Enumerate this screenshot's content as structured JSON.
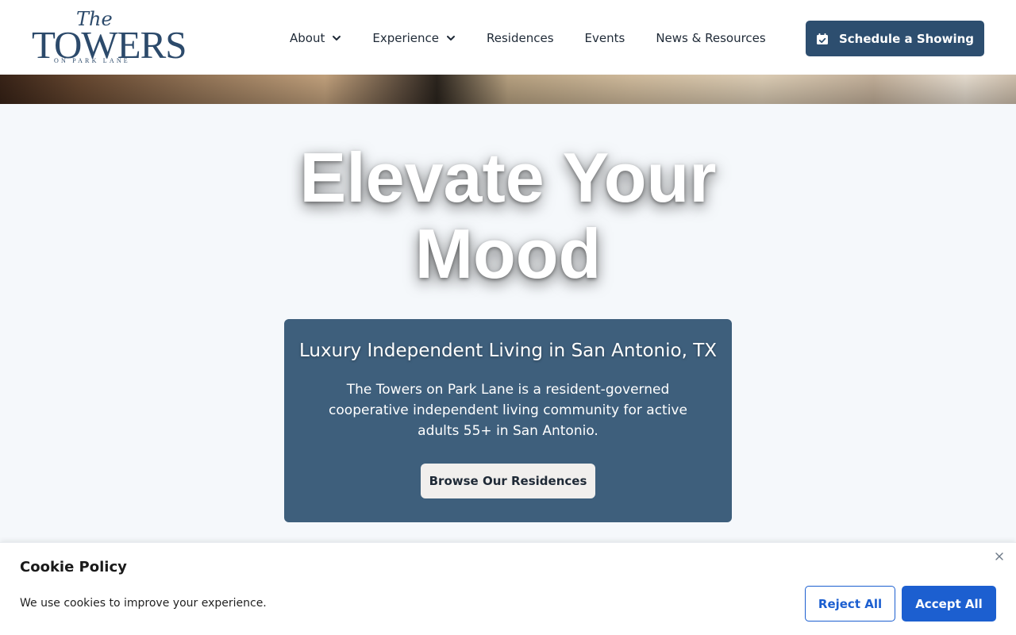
{
  "brand": {
    "logo_the": "The",
    "logo_towers": "TOWERS",
    "logo_sub": "ON PARK LANE"
  },
  "nav": {
    "items": [
      {
        "label": "About",
        "has_dropdown": true
      },
      {
        "label": "Experience",
        "has_dropdown": true
      },
      {
        "label": "Residences",
        "has_dropdown": false
      },
      {
        "label": "Events",
        "has_dropdown": false
      },
      {
        "label": "News & Resources",
        "has_dropdown": false
      }
    ],
    "cta_label": "Schedule a Showing",
    "cta_icon": "calendar-check-icon"
  },
  "hero": {
    "headline_line1": "Elevate Your",
    "headline_line2": "Mood",
    "card_title": "Luxury Independent Living in San Antonio, TX",
    "card_body": "The Towers on Park Lane is a resident-governed cooperative independent living community for active adults 55+ in San Antonio.",
    "card_button": "Browse Our Residences"
  },
  "cookie": {
    "title": "Cookie Policy",
    "text": "We use cookies to improve your experience.",
    "reject_label": "Reject All",
    "accept_label": "Accept All",
    "close_icon": "close-icon"
  },
  "colors": {
    "brand_navy": "#2d4e6f",
    "card_blue": "#3e5f7c",
    "accept_blue": "#1c5fd0",
    "page_bg": "#f5f8fb"
  }
}
